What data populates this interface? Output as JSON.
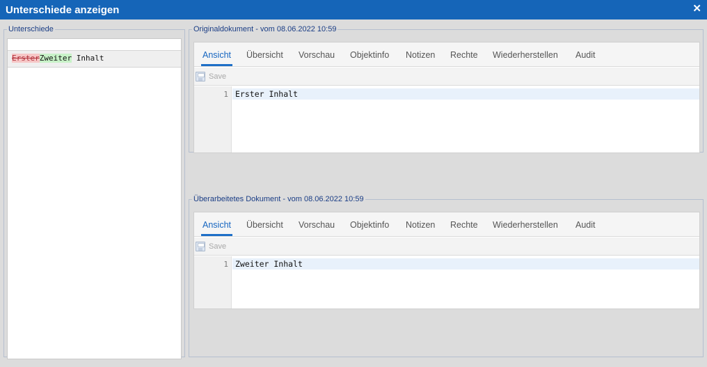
{
  "window": {
    "title": "Unterschiede anzeigen",
    "close_symbol": "✕"
  },
  "left_panel": {
    "legend": "Unterschiede",
    "diff": {
      "deleted": "Erster",
      "inserted": "Zweiter",
      "rest": " Inhalt"
    }
  },
  "original": {
    "legend": "Originaldokument - vom 08.06.2022 10:59",
    "tabs": [
      "Ansicht",
      "Übersicht",
      "Vorschau",
      "Objektinfo",
      "Notizen",
      "Rechte",
      "Wiederherstellen",
      "Audit"
    ],
    "active_tab": "Ansicht",
    "save_label": "Save",
    "line_number": "1",
    "content": "Erster Inhalt"
  },
  "revised": {
    "legend": "Überarbeitetes Dokument - vom 08.06.2022 10:59",
    "tabs": [
      "Ansicht",
      "Übersicht",
      "Vorschau",
      "Objektinfo",
      "Notizen",
      "Rechte",
      "Wiederherstellen",
      "Audit"
    ],
    "active_tab": "Ansicht",
    "save_label": "Save",
    "line_number": "1",
    "content": "Zweiter Inhalt"
  },
  "colors": {
    "titlebar": "#1565b8",
    "legend_text": "#1a3d85",
    "active_tab": "#1565c0",
    "deleted_bg": "#f6c6c6",
    "inserted_bg": "#c8f2c8"
  },
  "icons": {
    "close": "close-icon",
    "save": "floppy-disk-icon"
  }
}
